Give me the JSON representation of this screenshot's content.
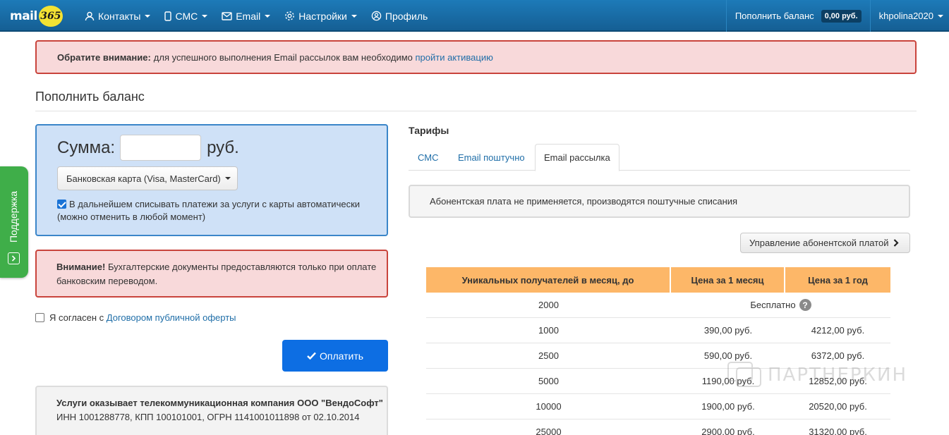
{
  "brand": {
    "text": "mail",
    "badge": "365"
  },
  "nav": {
    "contacts": "Контакты",
    "sms": "СМС",
    "email": "Email",
    "settings": "Настройки",
    "profile": "Профиль",
    "topup": "Пополнить баланс",
    "balance": "0,00 руб.",
    "user": "khpolina2020"
  },
  "alert_top": {
    "strong": "Обратите внимание:",
    "text": "для успешного выполнения Email рассылок вам необходимо",
    "link": "пройти активацию"
  },
  "page_title": "Пополнить баланс",
  "sum": {
    "label": "Сумма:",
    "value": "",
    "unit": "руб.",
    "method": "Банковская карта (Visa, MasterCard)",
    "autopay": "В дальнейшем списывать платежи за услуги с карты автоматически (можно отменить в любой момент)",
    "autopay_checked": true
  },
  "alert_warn": {
    "strong": "Внимание!",
    "text": "Бухгалтерские документы предоставляются только при оплате банковским переводом."
  },
  "agree": {
    "text": "Я согласен с",
    "link": "Договором публичной оферты",
    "checked": false
  },
  "pay_button": "Оплатить",
  "company": {
    "line1": "Услуги оказывает телекоммуникационная компания ООО \"ВендоСофт\"",
    "line2": "ИНН 1001288778, КПП 100101001, ОГРН 1141001011898 от 02.10.2014"
  },
  "tariffs": {
    "title": "Тарифы",
    "tabs": [
      {
        "label": "СМС",
        "active": false
      },
      {
        "label": "Email поштучно",
        "active": false
      },
      {
        "label": "Email рассылка",
        "active": true
      }
    ],
    "info": "Абонентская плата не применяется, производятся поштучные списания",
    "manage_button": "Управление абонентской платой",
    "columns": [
      "Уникальных получателей в месяц, до",
      "Цена за 1 месяц",
      "Цена за 1 год"
    ],
    "free_row": {
      "recipients": "2000",
      "price": "Бесплатно"
    },
    "rows": [
      [
        "1000",
        "390,00 руб.",
        "4212,00 руб."
      ],
      [
        "2500",
        "590,00 руб.",
        "6372,00 руб."
      ],
      [
        "5000",
        "1190,00 руб.",
        "12852,00 руб."
      ],
      [
        "10000",
        "1900,00 руб.",
        "20520,00 руб."
      ],
      [
        "25000",
        "2900,00 руб.",
        "31320,00 руб."
      ]
    ]
  },
  "support": "Поддержка",
  "watermark": "ПАРТНЕРКИН",
  "colors": {
    "navbar": "#1d7ab8",
    "accent": "#0d6ee3",
    "table_header": "#fdb768",
    "support": "#3fae49"
  }
}
